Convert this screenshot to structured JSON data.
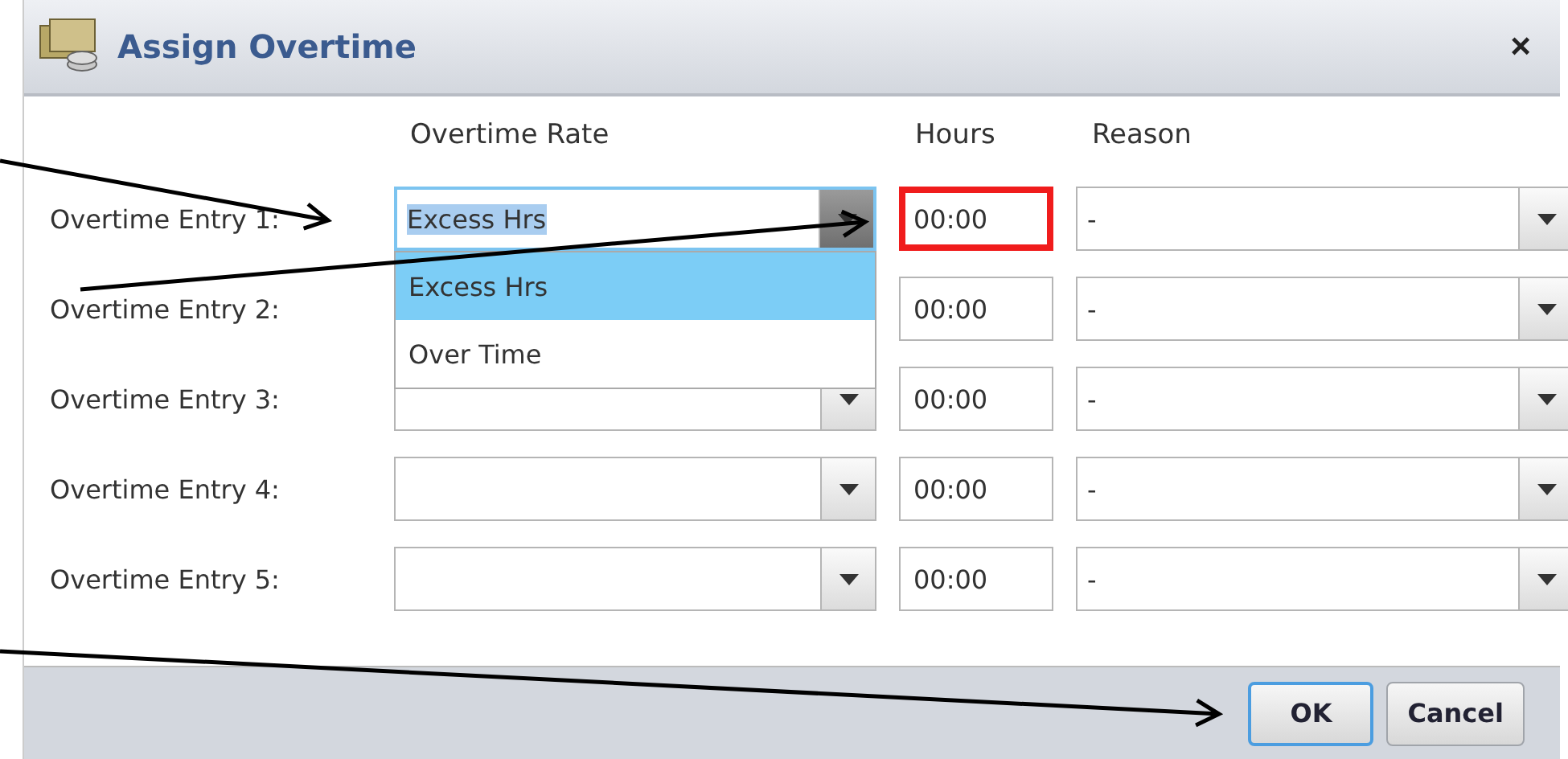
{
  "dialog": {
    "title": "Assign Overtime",
    "close": "×"
  },
  "columns": [
    "Overtime Rate",
    "Hours",
    "Reason"
  ],
  "entries": [
    {
      "label": "Overtime Entry 1:",
      "rate": "Excess Hrs",
      "open": true,
      "hours": "00:00",
      "highlighted": true,
      "reason": "-"
    },
    {
      "label": "Overtime Entry 2:",
      "open": false,
      "hours": "00:00",
      "highlighted": false,
      "reason": "-"
    },
    {
      "label": "Overtime Entry 3:",
      "open": false,
      "hours": "00:00",
      "highlighted": false,
      "reason": "-"
    },
    {
      "label": "Overtime Entry 4:",
      "open": false,
      "hours": "00:00",
      "highlighted": false,
      "reason": "-"
    },
    {
      "label": "Overtime Entry 5:",
      "open": false,
      "hours": "00:00",
      "highlighted": false,
      "reason": "-"
    }
  ],
  "rate_options": [
    {
      "label": "Excess Hrs",
      "selected": true
    },
    {
      "label": "Over Time",
      "selected": false
    }
  ],
  "buttons": [
    {
      "label": "OK",
      "focused": true
    },
    {
      "label": "Cancel",
      "focused": false
    }
  ]
}
